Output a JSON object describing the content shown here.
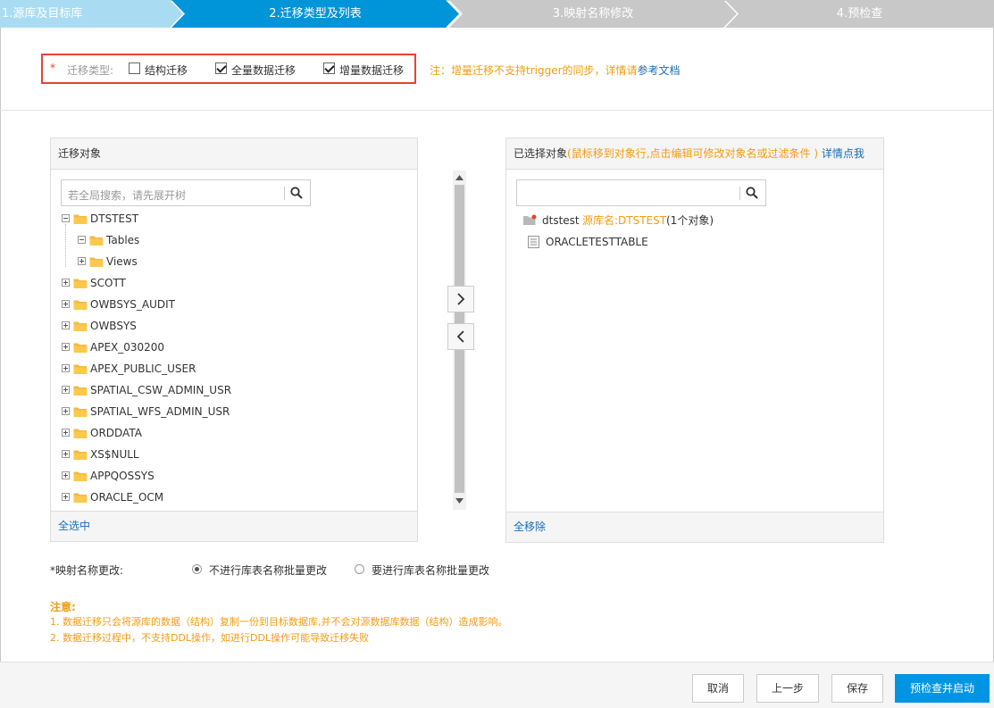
{
  "steps": [
    {
      "label": "1.源库及目标库",
      "state": "done"
    },
    {
      "label": "2.迁移类型及列表",
      "state": "active"
    },
    {
      "label": "3.映射名称修改",
      "state": "todo"
    },
    {
      "label": "4.预检查",
      "state": "todo"
    }
  ],
  "migration_type": {
    "required_mark": "*",
    "label": "迁移类型:",
    "options": [
      {
        "label": "结构迁移",
        "checked": false
      },
      {
        "label": "全量数据迁移",
        "checked": true
      },
      {
        "label": "增量数据迁移",
        "checked": true
      }
    ],
    "note_prefix": "注：增量迁移不支持trigger的同步，详情请",
    "note_link": "参考文档"
  },
  "source_panel": {
    "title": "迁移对象",
    "search_placeholder": "若全局搜索，请先展开树",
    "tree": [
      {
        "label": "DTSTEST",
        "expanded": true,
        "level": 0
      },
      {
        "label": "Tables",
        "expanded": true,
        "level": 1
      },
      {
        "label": "Views",
        "expanded": false,
        "level": 1
      },
      {
        "label": "SCOTT",
        "expanded": false,
        "level": 0
      },
      {
        "label": "OWBSYS_AUDIT",
        "expanded": false,
        "level": 0
      },
      {
        "label": "OWBSYS",
        "expanded": false,
        "level": 0
      },
      {
        "label": "APEX_030200",
        "expanded": false,
        "level": 0
      },
      {
        "label": "APEX_PUBLIC_USER",
        "expanded": false,
        "level": 0
      },
      {
        "label": "SPATIAL_CSW_ADMIN_USR",
        "expanded": false,
        "level": 0
      },
      {
        "label": "SPATIAL_WFS_ADMIN_USR",
        "expanded": false,
        "level": 0
      },
      {
        "label": "ORDDATA",
        "expanded": false,
        "level": 0
      },
      {
        "label": "XS$NULL",
        "expanded": false,
        "level": 0
      },
      {
        "label": "APPQOSSYS",
        "expanded": false,
        "level": 0
      },
      {
        "label": "ORACLE_OCM",
        "expanded": false,
        "level": 0
      }
    ],
    "footer": "全选中"
  },
  "selected_panel": {
    "title": "已选择对象",
    "hint": "(鼠标移到对象行,点击编辑可修改对象名或过滤条件 )",
    "hint_link": "详情点我",
    "search_placeholder": "",
    "db_name": "dtstest",
    "db_source": "源库名:DTSTEST",
    "db_count": "(1个对象)",
    "table_name": "ORACLETESTTABLE",
    "footer": "全移除"
  },
  "mapping": {
    "label": "*映射名称更改:",
    "option_no": "不进行库表名称批量更改",
    "option_yes": "要进行库表名称批量更改",
    "selected": "no"
  },
  "notes": {
    "title": "注意:",
    "line1": "1. 数据迁移只会将源库的数据（结构）复制一份到目标数据库,并不会对源数据库数据（结构）造成影响。",
    "line2": "2. 数据迁移过程中，不支持DDL操作，如进行DDL操作可能导致迁移失败"
  },
  "buttons": {
    "cancel": "取消",
    "prev": "上一步",
    "save": "保存",
    "precheck": "预检查并启动"
  },
  "colors": {
    "step_done": "#a9dcf3",
    "step_active": "#0095d9",
    "step_todo": "#c8c8c8",
    "highlight_border": "#e8432f",
    "note": "#f39c12",
    "link": "#1a6cb8",
    "primary": "#0095e3"
  }
}
